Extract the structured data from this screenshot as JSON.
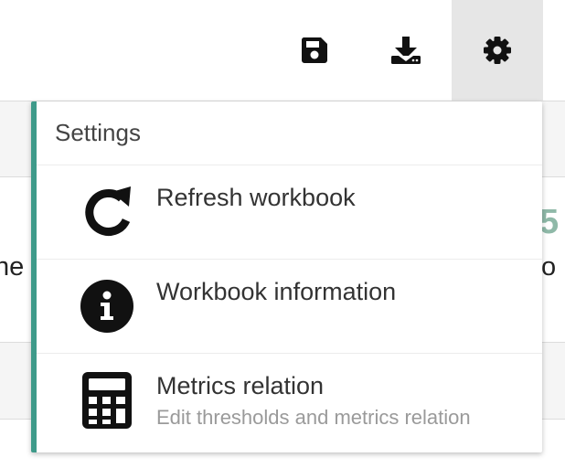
{
  "toolbar": {
    "buttons": [
      {
        "icon": "save-icon"
      },
      {
        "icon": "download-icon"
      },
      {
        "icon": "gear-icon",
        "active": true
      }
    ]
  },
  "background": {
    "left_fragment": "the",
    "right_fragment": "fo",
    "number_fragment": "5"
  },
  "menu": {
    "header": "Settings",
    "accent_color": "#3e9a8a",
    "items": [
      {
        "icon": "refresh-icon",
        "title": "Refresh workbook",
        "subtitle": ""
      },
      {
        "icon": "info-icon",
        "title": "Workbook information",
        "subtitle": ""
      },
      {
        "icon": "calculator-icon",
        "title": "Metrics relation",
        "subtitle": "Edit thresholds and metrics relation"
      }
    ]
  }
}
